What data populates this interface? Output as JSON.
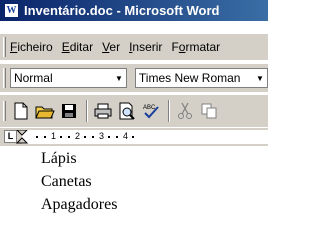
{
  "window": {
    "title": "Inventário.doc - Microsoft Word",
    "icon": "word-doc-icon"
  },
  "menu": [
    {
      "accel": "F",
      "rest": "icheiro"
    },
    {
      "accel": "E",
      "rest": "ditar"
    },
    {
      "accel": "V",
      "rest": "er"
    },
    {
      "accel": "I",
      "rest": "nserir"
    },
    {
      "pre": "F",
      "accel": "o",
      "rest": "rmatar"
    }
  ],
  "formatting": {
    "style": "Normal",
    "font": "Times New Roman"
  },
  "toolbar": {
    "icons": [
      "new-document-icon",
      "open-folder-icon",
      "save-disk-icon",
      "print-icon",
      "print-preview-icon",
      "spelling-check-icon",
      "cut-icon",
      "copy-icon"
    ]
  },
  "ruler": {
    "tab_selector": "L",
    "numbers": [
      "1",
      "2",
      "3",
      "4"
    ]
  },
  "document": {
    "lines": [
      "Lápis",
      "Canetas",
      "Apagadores"
    ]
  }
}
